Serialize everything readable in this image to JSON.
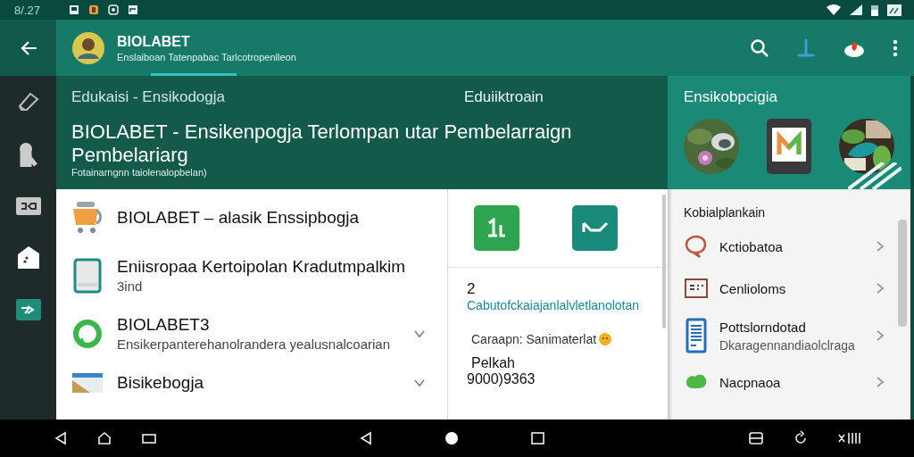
{
  "status_bar": {
    "time": "8/.27"
  },
  "app_bar": {
    "title": "BIOLABET",
    "subtitle": "Enslaiboan Tatenpabac Tarlcotropenlleon"
  },
  "header": {
    "breadcrumb": "Edukaisi  - Ensikodogja",
    "section_label": "Eduiiktroain",
    "title": "BIOLABET - Ensikenpogja Terlompan utar Pembelarraign Pembelariarg",
    "note": "Fotainarngnn taiolenalopbelan)"
  },
  "list": [
    {
      "title": "BIOLABET – alasik Enssipbogja",
      "chevron": false
    },
    {
      "title": "Eniisropaa Kertoipolan Kradutmpalkim",
      "subtitle": "3ind",
      "chevron": false
    },
    {
      "title": "BIOLABET3",
      "subtitle": "Ensikerpanterehanolrandera yealusnalcoarian",
      "chevron": true
    },
    {
      "title": "Bisikebogja",
      "chevron": true
    }
  ],
  "detail": {
    "count": "2",
    "link": "Cabutofckaiajanlalvletlanolotan",
    "caption": "Caraapn: Sanimaterlat",
    "label": "Pelkah",
    "number": "9000)9363"
  },
  "panel": {
    "title": "Ensikobpcigia",
    "menu_title": "Kobialplankain",
    "items": [
      {
        "label": "Kctiobatoa"
      },
      {
        "label": "Cenlioloms"
      },
      {
        "label": "Pottslorndotad",
        "subtitle": "Dkaragennandiaolclraga"
      },
      {
        "label": "Nacpnaoa"
      }
    ]
  }
}
